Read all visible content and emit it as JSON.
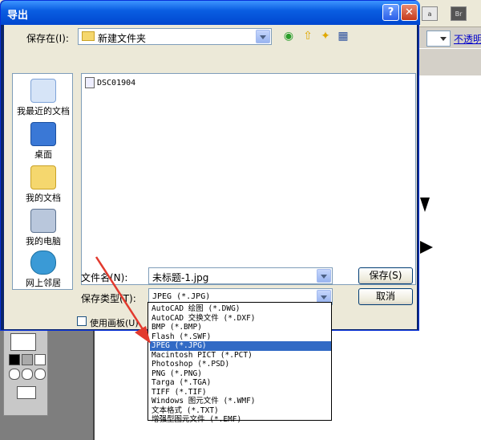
{
  "background": {
    "br_button": "Br",
    "opacity_label": "不透明"
  },
  "dialog": {
    "title": "导出",
    "help_glyph": "?",
    "close_glyph": "✕",
    "save_in_label": "保存在(I):",
    "save_in_value": "新建文件夹",
    "places": [
      {
        "label": "我最近的文档",
        "icon": "recent-docs-icon"
      },
      {
        "label": "桌面",
        "icon": "desktop-icon"
      },
      {
        "label": "我的文档",
        "icon": "my-documents-icon"
      },
      {
        "label": "我的电脑",
        "icon": "my-computer-icon"
      },
      {
        "label": "网上邻居",
        "icon": "network-icon"
      }
    ],
    "files": [
      {
        "name": "DSC01904"
      }
    ],
    "filename_label": "文件名(N):",
    "filename_value": "未标题-1.jpg",
    "filetype_label": "保存类型(T):",
    "filetype_value": "JPEG (*.JPG)",
    "save_button": "保存(S)",
    "cancel_button": "取消",
    "use_artboard_label": "使用画板(U)",
    "type_options": [
      "AutoCAD 绘图 (*.DWG)",
      "AutoCAD 交换文件 (*.DXF)",
      "BMP (*.BMP)",
      "Flash (*.SWF)",
      "JPEG (*.JPG)",
      "Macintosh PICT (*.PCT)",
      "Photoshop (*.PSD)",
      "PNG (*.PNG)",
      "Targa (*.TGA)",
      "TIFF (*.TIF)",
      "Windows 图元文件 (*.WMF)",
      "文本格式 (*.TXT)",
      "增强型图元文件 (*.EMF)"
    ],
    "selected_index": 4
  },
  "colors": {
    "annotation_arrow": "#e23a2e",
    "selection": "#316ac5"
  }
}
